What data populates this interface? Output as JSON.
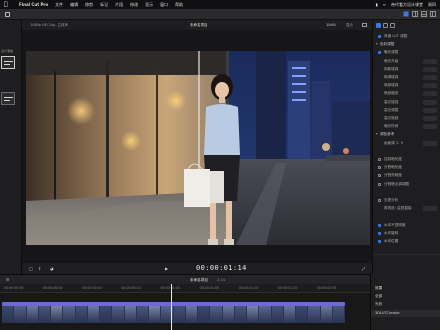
{
  "menubar": {
    "app_name": "Final Cut Pro",
    "items": [
      "文件",
      "编辑",
      "修剪",
      "标记",
      "片段",
      "修改",
      "显示",
      "窗口",
      "帮助"
    ],
    "right_text": "帝代看方设计课堂",
    "clock": "周四"
  },
  "left_panel": {
    "title": "设计课堂"
  },
  "viewer": {
    "format": "1080p HD 24p, 立体声",
    "quality": "",
    "title": "未命名项目",
    "zoom": "104%",
    "view_label": "显示",
    "timecode": "00:00:01:14"
  },
  "inspector": {
    "rows": [
      {
        "type": "cb",
        "on": true,
        "label": "风格 LUT 调整"
      },
      {
        "type": "sec",
        "label": "色彩调整"
      },
      {
        "type": "cb",
        "on": true,
        "label": "曝光调整"
      },
      {
        "type": "lbl",
        "label": "暗光升级"
      },
      {
        "type": "lbl",
        "label": "阴影增强"
      },
      {
        "type": "lbl",
        "label": "暗调增强"
      },
      {
        "type": "lbl",
        "label": "暗部增强"
      },
      {
        "type": "lbl",
        "label": "暗部缩放"
      },
      {
        "type": "lbl",
        "label": "高光增强"
      },
      {
        "type": "lbl",
        "label": "高光调整"
      },
      {
        "type": "lbl",
        "label": "高光暗部"
      },
      {
        "type": "lbl",
        "label": "暗光时间"
      },
      {
        "type": "sec",
        "label": "调色参考"
      },
      {
        "type": "lbl",
        "label": "画面调 1: 9"
      },
      {
        "type": "lbl",
        "label": ""
      },
      {
        "type": "cb",
        "on": false,
        "label": "控制暗化度"
      },
      {
        "type": "cb",
        "on": false,
        "label": "分割暗化度"
      },
      {
        "type": "cb",
        "on": false,
        "label": "分割亮暗度"
      },
      {
        "type": "cb",
        "on": false,
        "label": "分割暗点调调图"
      },
      {
        "type": "lbl",
        "label": ""
      },
      {
        "type": "cb",
        "on": false,
        "label": "无损分析"
      },
      {
        "type": "lbl",
        "label": "再现选: 监视直接"
      },
      {
        "type": "lbl",
        "label": ""
      },
      {
        "type": "cb",
        "on": true,
        "label": "水印不透明度"
      },
      {
        "type": "cb",
        "on": true,
        "label": "水印旋转"
      },
      {
        "type": "cb",
        "on": true,
        "label": "水印位置"
      }
    ]
  },
  "timeline": {
    "project": "未命名项目",
    "duration": "2:14",
    "ruler_ticks": [
      "00:00:00:00",
      "00:00:00:05",
      "00:00:00:10",
      "00:00:00:15",
      "00:00:01:00",
      "00:00:01:05",
      "00:00:01:10",
      "00:00:01:15",
      "00:00:02:00"
    ]
  },
  "index": {
    "title": "效果",
    "all": "全部",
    "category": "光效",
    "item": "3DLUTCreator"
  },
  "colors": {
    "accent": "#3a7ae0",
    "clip": "#6f68d6"
  }
}
